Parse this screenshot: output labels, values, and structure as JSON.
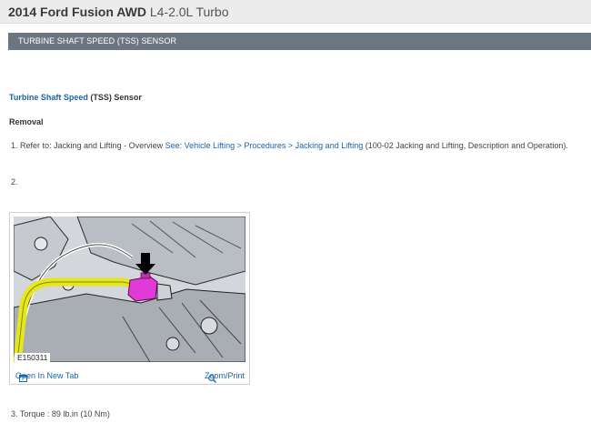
{
  "header": {
    "model": "2014 Ford Fusion AWD",
    "engine": "L4-2.0L Turbo"
  },
  "section": {
    "title": "TURBINE SHAFT SPEED (TSS) SENSOR"
  },
  "content": {
    "heading_link": "Turbine Shaft Speed",
    "heading_rest": " (TSS) Sensor",
    "removal": "Removal",
    "step1_prefix": "1. Refer to: Jacking and Lifting - Overview ",
    "step1_link": "See: Vehicle Lifting > Procedures > Jacking and Lifting",
    "step1_suffix": " (100-02 Jacking and Lifting, Description and Operation).",
    "step2": "2.",
    "step3": "3. Torque : 89 lb.in (10 Nm)"
  },
  "figure": {
    "label": "E150311",
    "open_tab": "Open In New Tab",
    "zoom": "Zoom/Print",
    "icons": {
      "open": "new-tab-icon",
      "zoom": "magnifier-icon"
    },
    "colors": {
      "harness": "#e6e61c",
      "connector": "#e03ad8",
      "arrow": "#000000"
    }
  }
}
